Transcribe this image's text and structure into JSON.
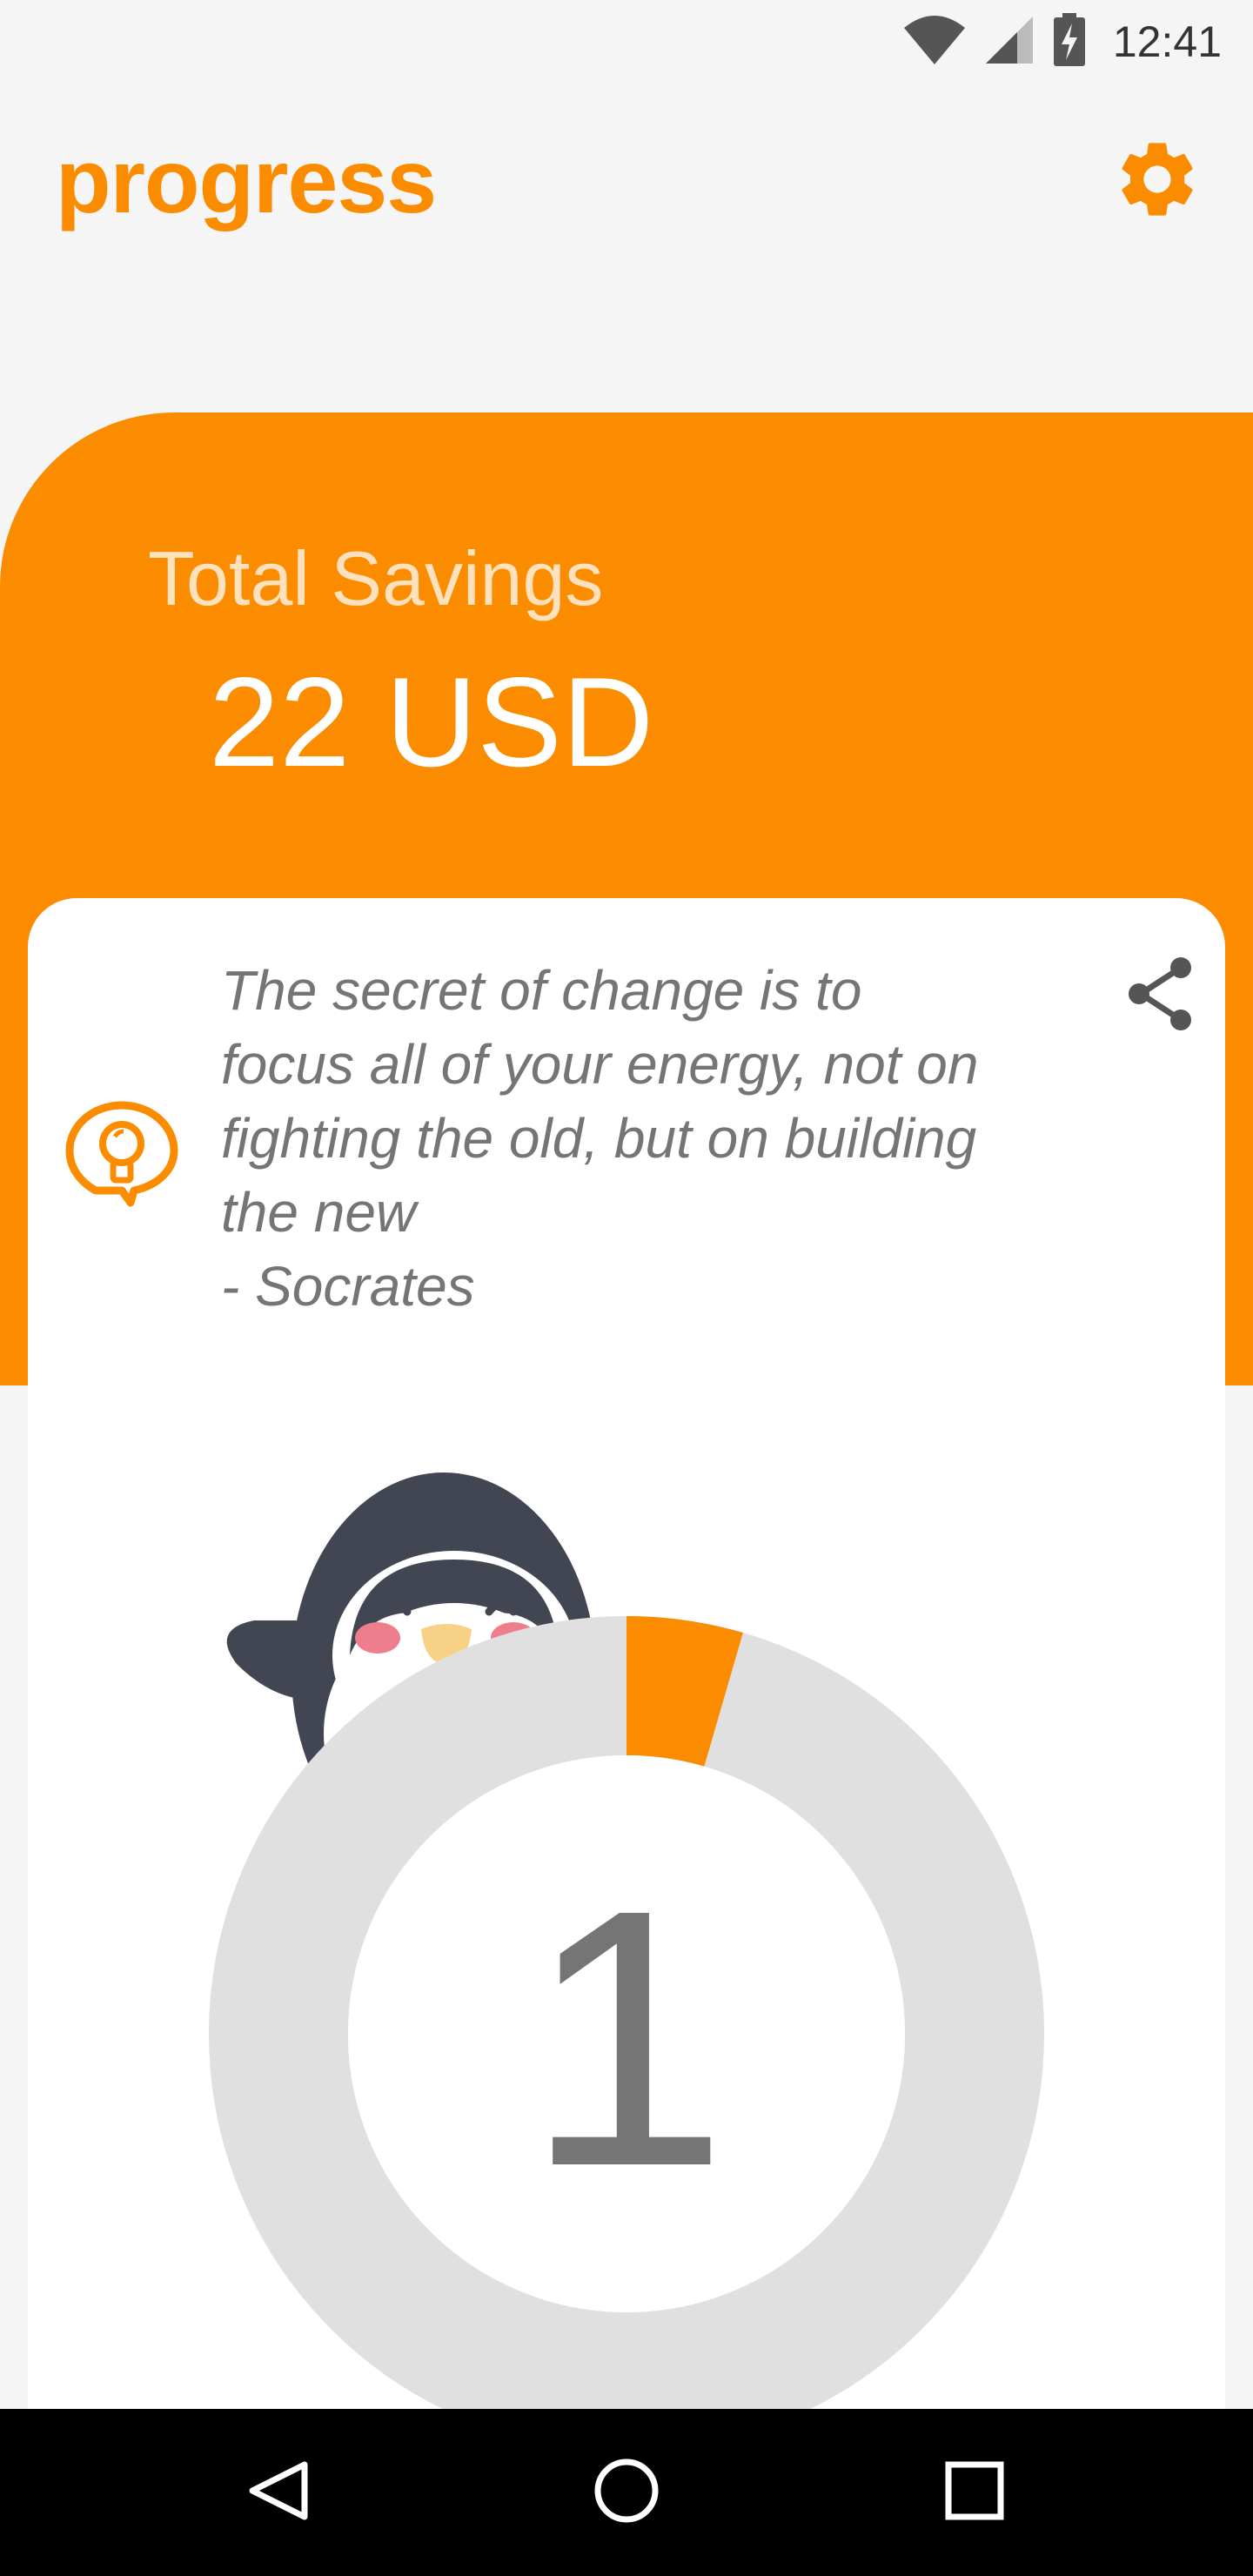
{
  "status_bar": {
    "time": "12:41",
    "icons": [
      "wifi-icon",
      "cell-signal-icon",
      "battery-charging-icon"
    ]
  },
  "header": {
    "title": "progress",
    "settings_icon": "gear-icon"
  },
  "savings": {
    "label": "Total Savings",
    "value": "22 USD"
  },
  "quote": {
    "icon": "lightbulb-chat-icon",
    "text": "The secret of change is to\nfocus all of your energy, not on\nfighting the old, but on building\nthe new\n- Socrates",
    "share_icon": "share-icon"
  },
  "progress": {
    "number": "1",
    "fraction": 0.045,
    "ring_color": "#fb8c00",
    "track_color": "#e0e0e0"
  },
  "nav_bar": {
    "icons": [
      "back-icon",
      "home-icon",
      "recents-icon"
    ]
  },
  "colors": {
    "accent": "#fb8c00",
    "background": "#f5f5f5",
    "card": "#ffffff",
    "text_muted": "#757575"
  }
}
